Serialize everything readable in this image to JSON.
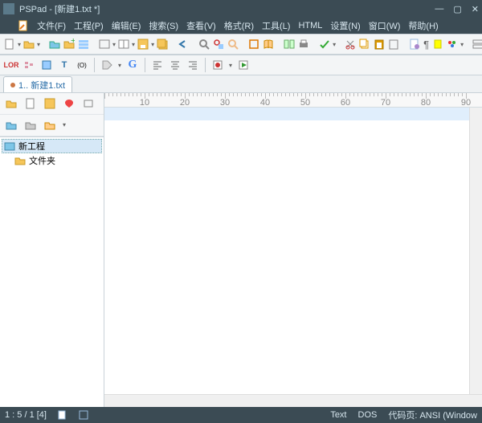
{
  "title": "PSPad - [新建1.txt *]",
  "menu": [
    "文件(F)",
    "工程(P)",
    "编辑(E)",
    "搜索(S)",
    "查看(V)",
    "格式(R)",
    "工具(L)",
    "HTML",
    "设置(N)",
    "窗口(W)",
    "帮助(H)"
  ],
  "tab": {
    "label": "1.. 新建1.txt"
  },
  "sidebar": {
    "project_root": "新工程",
    "folder": "文件夹"
  },
  "ruler": {
    "max": 90,
    "step": 10
  },
  "status": {
    "pos": "1 : 5 / 1 [4]",
    "syntax": "Text",
    "eol": "DOS",
    "codepage_label": "代码页:",
    "codepage": "ANSI (Window"
  },
  "colors": {
    "accent": "#3b4b54",
    "tab_text": "#2a6ea8",
    "highlight_line": "#e0eefc"
  }
}
